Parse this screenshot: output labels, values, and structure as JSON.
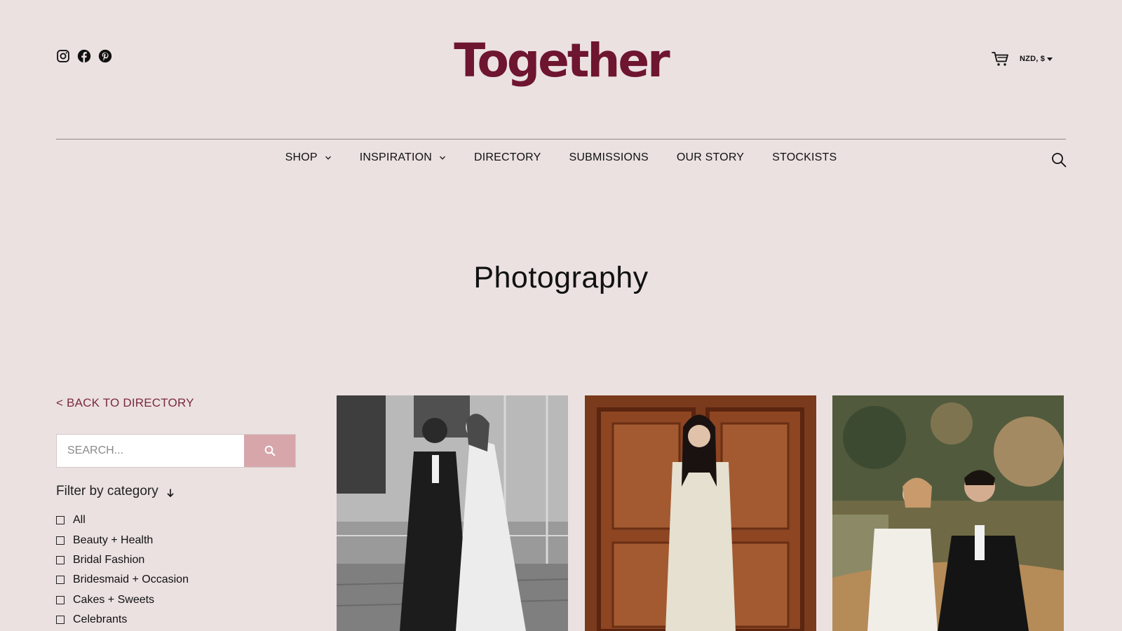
{
  "header": {
    "logo": "Together",
    "currency": "NZD, $",
    "social": [
      "instagram-icon",
      "facebook-icon",
      "pinterest-icon"
    ]
  },
  "nav": {
    "items": [
      {
        "label": "SHOP",
        "dropdown": true
      },
      {
        "label": "INSPIRATION",
        "dropdown": true
      },
      {
        "label": "DIRECTORY",
        "dropdown": false
      },
      {
        "label": "SUBMISSIONS",
        "dropdown": false
      },
      {
        "label": "OUR STORY",
        "dropdown": false
      },
      {
        "label": "STOCKISTS",
        "dropdown": false
      }
    ]
  },
  "page": {
    "title": "Photography"
  },
  "sidebar": {
    "back_label": "< BACK TO DIRECTORY",
    "search_placeholder": "SEARCH...",
    "filter_title": "Filter by category",
    "categories": [
      {
        "label": "All"
      },
      {
        "label": "Beauty + Health"
      },
      {
        "label": "Bridal Fashion"
      },
      {
        "label": "Bridesmaid + Occasion"
      },
      {
        "label": "Cakes + Sweets"
      },
      {
        "label": "Celebrants"
      }
    ]
  },
  "colors": {
    "background": "#ebe1e1",
    "brand": "#6e1530",
    "link": "#7b2a3e",
    "search_button": "#d7a6aa"
  }
}
